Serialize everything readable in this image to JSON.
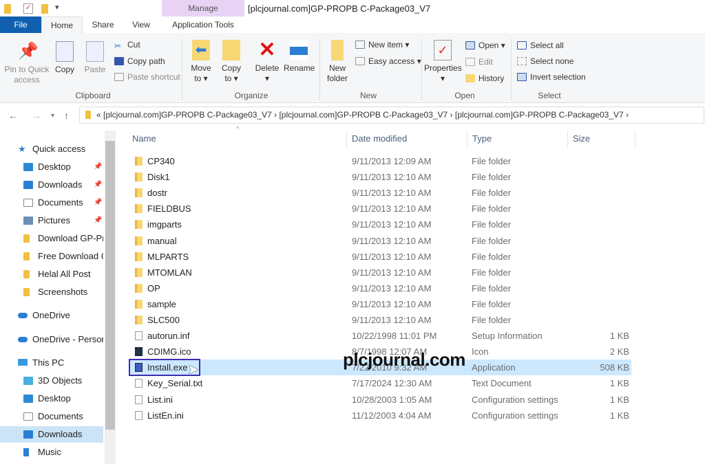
{
  "window": {
    "title": "[plcjournal.com]GP-PROPB C-Package03_V7",
    "context_tab": "Manage",
    "context_group": "Application Tools"
  },
  "tabs": [
    "File",
    "Home",
    "Share",
    "View"
  ],
  "ribbon": {
    "clipboard": {
      "label": "Clipboard",
      "pin": "Pin to Quick access",
      "copy": "Copy",
      "paste": "Paste",
      "cut": "Cut",
      "copy_path": "Copy path",
      "paste_shortcut": "Paste shortcut"
    },
    "organize": {
      "label": "Organize",
      "move_to": "Move to",
      "copy_to": "Copy to",
      "delete": "Delete",
      "rename": "Rename"
    },
    "new": {
      "label": "New",
      "new_folder": "New folder",
      "new_item": "New item",
      "easy_access": "Easy access"
    },
    "open": {
      "label": "Open",
      "properties": "Properties",
      "open": "Open",
      "edit": "Edit",
      "history": "History"
    },
    "select": {
      "label": "Select",
      "select_all": "Select all",
      "select_none": "Select none",
      "invert": "Invert selection"
    }
  },
  "address": {
    "path": "«  [plcjournal.com]GP-PROPB C-Package03_V7  ›  [plcjournal.com]GP-PROPB C-Package03_V7  ›  [plcjournal.com]GP-PROPB C-Package03_V7  ›"
  },
  "sidebar": [
    {
      "label": "Quick access",
      "type": "star",
      "pinned": false
    },
    {
      "label": "Desktop",
      "type": "desktop",
      "pinned": true
    },
    {
      "label": "Downloads",
      "type": "download",
      "pinned": true
    },
    {
      "label": "Documents",
      "type": "docs",
      "pinned": true
    },
    {
      "label": "Pictures",
      "type": "pictures",
      "pinned": true
    },
    {
      "label": "Download GP-Pr",
      "type": "folder",
      "pinned": false
    },
    {
      "label": "Free Download C",
      "type": "folder",
      "pinned": false
    },
    {
      "label": "Helal All Post",
      "type": "folder",
      "pinned": false
    },
    {
      "label": "Screenshots",
      "type": "folder",
      "pinned": false
    },
    {
      "label": "OneDrive",
      "type": "cloud",
      "pinned": false
    },
    {
      "label": "OneDrive - Person",
      "type": "cloud",
      "pinned": false
    },
    {
      "label": "This PC",
      "type": "pc",
      "pinned": false
    },
    {
      "label": "3D Objects",
      "type": "3d",
      "pinned": false
    },
    {
      "label": "Desktop",
      "type": "desktop",
      "pinned": false
    },
    {
      "label": "Documents",
      "type": "docs",
      "pinned": false
    },
    {
      "label": "Downloads",
      "type": "download",
      "pinned": false,
      "selected": true
    },
    {
      "label": "Music",
      "type": "music",
      "pinned": false
    }
  ],
  "columns": [
    "Name",
    "Date modified",
    "Type",
    "Size"
  ],
  "files": [
    {
      "name": "CP340",
      "date": "9/11/2013 12:09 AM",
      "type": "File folder",
      "size": "",
      "icon": "folder"
    },
    {
      "name": "Disk1",
      "date": "9/11/2013 12:10 AM",
      "type": "File folder",
      "size": "",
      "icon": "folder"
    },
    {
      "name": "dostr",
      "date": "9/11/2013 12:10 AM",
      "type": "File folder",
      "size": "",
      "icon": "folder"
    },
    {
      "name": "FIELDBUS",
      "date": "9/11/2013 12:10 AM",
      "type": "File folder",
      "size": "",
      "icon": "folder"
    },
    {
      "name": "imgparts",
      "date": "9/11/2013 12:10 AM",
      "type": "File folder",
      "size": "",
      "icon": "folder"
    },
    {
      "name": "manual",
      "date": "9/11/2013 12:10 AM",
      "type": "File folder",
      "size": "",
      "icon": "folder"
    },
    {
      "name": "MLPARTS",
      "date": "9/11/2013 12:10 AM",
      "type": "File folder",
      "size": "",
      "icon": "folder"
    },
    {
      "name": "MTOMLAN",
      "date": "9/11/2013 12:10 AM",
      "type": "File folder",
      "size": "",
      "icon": "folder"
    },
    {
      "name": "OP",
      "date": "9/11/2013 12:10 AM",
      "type": "File folder",
      "size": "",
      "icon": "folder"
    },
    {
      "name": "sample",
      "date": "9/11/2013 12:10 AM",
      "type": "File folder",
      "size": "",
      "icon": "folder"
    },
    {
      "name": "SLC500",
      "date": "9/11/2013 12:10 AM",
      "type": "File folder",
      "size": "",
      "icon": "folder"
    },
    {
      "name": "autorun.inf",
      "date": "10/22/1998 11:01 PM",
      "type": "Setup Information",
      "size": "1 KB",
      "icon": "settings-file"
    },
    {
      "name": "CDIMG.ico",
      "date": "8/7/1998 12:07 AM",
      "type": "Icon",
      "size": "2 KB",
      "icon": "image-file"
    },
    {
      "name": "Install.exe",
      "date": "7/22/2010 9:32 AM",
      "type": "Application",
      "size": "508 KB",
      "icon": "app",
      "selected": true
    },
    {
      "name": "Key_Serial.txt",
      "date": "7/17/2024 12:30 AM",
      "type": "Text Document",
      "size": "1 KB",
      "icon": "text-file"
    },
    {
      "name": "List.ini",
      "date": "10/28/2003 1:05 AM",
      "type": "Configuration settings",
      "size": "1 KB",
      "icon": "settings-file"
    },
    {
      "name": "ListEn.ini",
      "date": "11/12/2003 4:04 AM",
      "type": "Configuration settings",
      "size": "1 KB",
      "icon": "settings-file"
    }
  ],
  "watermark": "plcjournal.com",
  "colors": {
    "file_tab": "#1160b0",
    "manage_tab": "#e8d3f5",
    "selection": "#cce8ff",
    "highlight_box": "#3c2cb3"
  }
}
